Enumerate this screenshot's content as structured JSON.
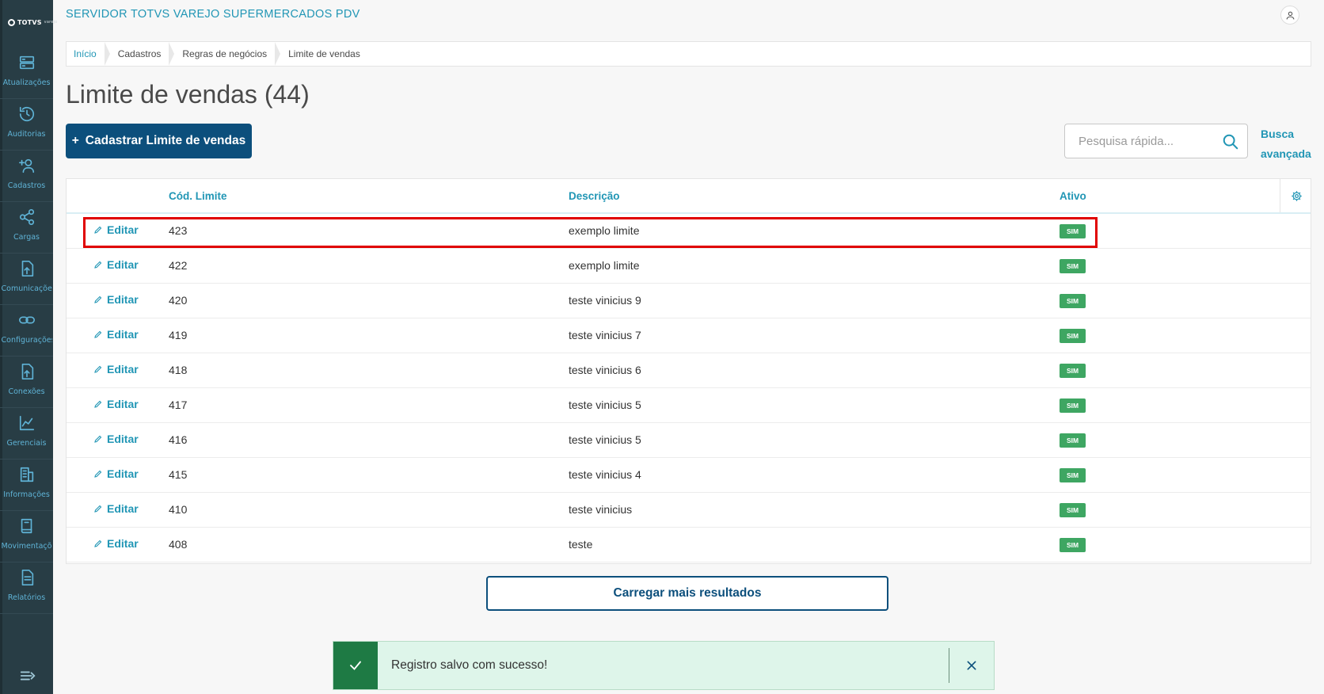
{
  "app": {
    "title": "SERVIDOR TOTVS VAREJO SUPERMERCADOS PDV",
    "logo_text": "TOTVS",
    "logo_sub": "varejo"
  },
  "sidebar": {
    "items": [
      {
        "label": "Atualizações",
        "icon": "server-icon"
      },
      {
        "label": "Auditorias",
        "icon": "history-icon"
      },
      {
        "label": "Cadastros",
        "icon": "user-add-icon"
      },
      {
        "label": "Cargas",
        "icon": "share-icon"
      },
      {
        "label": "Comunicações",
        "icon": "upload-file-icon"
      },
      {
        "label": "Configurações",
        "icon": "link-icon"
      },
      {
        "label": "Conexões",
        "icon": "upload-file-icon"
      },
      {
        "label": "Gerenciais",
        "icon": "chart-icon"
      },
      {
        "label": "Informações",
        "icon": "building-icon"
      },
      {
        "label": "Movimentações",
        "icon": "book-icon"
      },
      {
        "label": "Relatórios",
        "icon": "document-icon"
      }
    ]
  },
  "breadcrumb": [
    "Início",
    "Cadastros",
    "Regras de negócios",
    "Limite de vendas"
  ],
  "page": {
    "title": "Limite de vendas (44)",
    "add_button": "Cadastrar Limite de vendas",
    "add_prefix": "+",
    "search_placeholder": "Pesquisa rápida...",
    "advanced_search": "Busca avançada"
  },
  "table": {
    "columns": {
      "code": "Cód. Limite",
      "description": "Descrição",
      "active": "Ativo"
    },
    "edit_label": "Editar",
    "rows": [
      {
        "code": "423",
        "description": "exemplo limite",
        "active": "SIM"
      },
      {
        "code": "422",
        "description": "exemplo limite",
        "active": "SIM"
      },
      {
        "code": "420",
        "description": "teste vinicius 9",
        "active": "SIM"
      },
      {
        "code": "419",
        "description": "teste vinicius 7",
        "active": "SIM"
      },
      {
        "code": "418",
        "description": "teste vinicius 6",
        "active": "SIM"
      },
      {
        "code": "417",
        "description": "teste vinicius 5",
        "active": "SIM"
      },
      {
        "code": "416",
        "description": "teste vinicius 5",
        "active": "SIM"
      },
      {
        "code": "415",
        "description": "teste vinicius 4",
        "active": "SIM"
      },
      {
        "code": "410",
        "description": "teste vinicius",
        "active": "SIM"
      },
      {
        "code": "408",
        "description": "teste",
        "active": "SIM"
      }
    ],
    "load_more": "Carregar mais resultados"
  },
  "toast": {
    "message": "Registro salvo com sucesso!",
    "type": "success"
  },
  "colors": {
    "sidebar": "#283d45",
    "accent": "#2196b5",
    "primary_button": "#0c4f7c",
    "active_badge": "#3ea662",
    "highlight": "#e00000"
  }
}
